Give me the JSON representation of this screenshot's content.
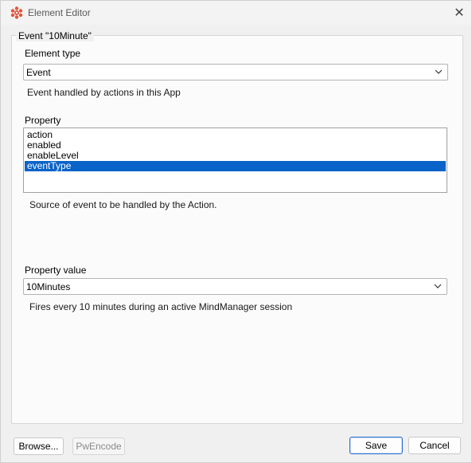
{
  "window": {
    "title": "Element Editor",
    "close_symbol": "✕"
  },
  "group": {
    "legend": "Event  \"10Minute\""
  },
  "element_type": {
    "label": "Element type",
    "value": "Event",
    "description": "Event handled by actions in this App"
  },
  "property": {
    "label": "Property",
    "items": [
      "action",
      "enabled",
      "enableLevel",
      "eventType"
    ],
    "selected": "eventType",
    "description": "Source of event to be handled by the Action."
  },
  "property_value": {
    "label": "Property value",
    "value": "10Minutes",
    "description": "Fires every 10 minutes during an active MindManager session"
  },
  "buttons": {
    "browse": "Browse...",
    "pwencode": "PwEncode",
    "save": "Save",
    "cancel": "Cancel"
  },
  "colors": {
    "selection": "#0a63c8",
    "app_icon": "#e2543a",
    "primary_border": "#2a6fce"
  },
  "icons": {
    "app": "mindmanager-logo-icon",
    "close": "close-icon",
    "dropdown": "chevron-down-icon"
  }
}
